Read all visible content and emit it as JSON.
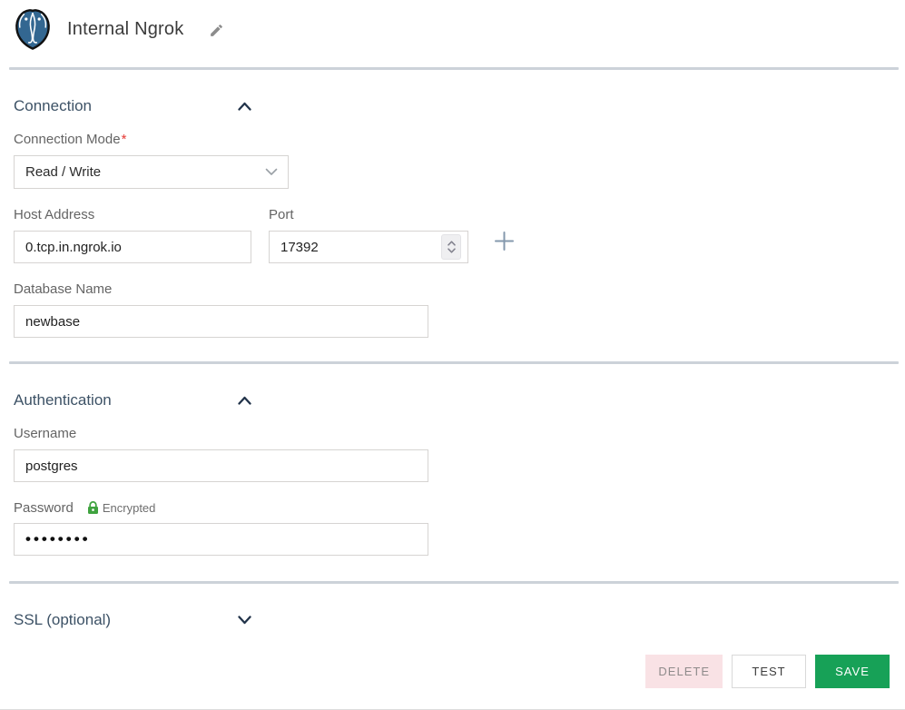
{
  "header": {
    "title": "Internal Ngrok",
    "logo_icon": "postgresql-elephant-logo",
    "edit_icon": "pencil-icon"
  },
  "sections": {
    "connection": {
      "title": "Connection",
      "collapsed": false,
      "collapse_icon": "chevron-up-icon",
      "fields": {
        "connection_mode": {
          "label": "Connection Mode",
          "required_mark": "*",
          "value": "Read / Write",
          "control": "dropdown"
        },
        "host_address": {
          "label": "Host Address",
          "value": "0.tcp.in.ngrok.io"
        },
        "port": {
          "label": "Port",
          "value": "17392",
          "control": "number-stepper"
        },
        "database_name": {
          "label": "Database Name",
          "value": "newbase"
        }
      },
      "add_icon": "plus-icon"
    },
    "authentication": {
      "title": "Authentication",
      "collapsed": false,
      "collapse_icon": "chevron-up-icon",
      "fields": {
        "username": {
          "label": "Username",
          "value": "postgres"
        },
        "password": {
          "label": "Password",
          "badge_icon": "lock-icon",
          "badge": "Encrypted",
          "value": "••••••••"
        }
      }
    },
    "ssl": {
      "title": "SSL (optional)",
      "collapsed": true,
      "collapse_icon": "chevron-down-icon"
    }
  },
  "footer": {
    "delete_label": "DELETE",
    "test_label": "TEST",
    "save_label": "SAVE"
  },
  "colors": {
    "save_green": "#17a157",
    "delete_pink_bg": "#f9e2e5",
    "section_title": "#3d5266",
    "divider": "#ccd2d9",
    "encrypted_green": "#3fa33f",
    "logo_blue": "#336791",
    "required_red": "#e53935"
  }
}
